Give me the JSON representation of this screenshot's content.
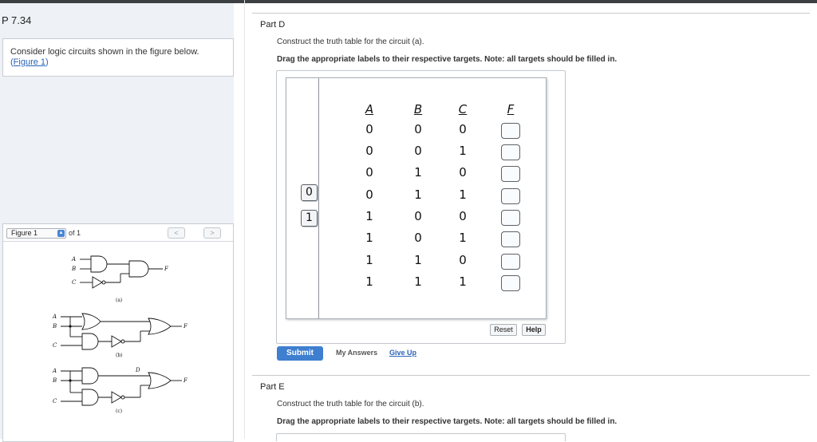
{
  "problem": {
    "title": "P 7.34",
    "context": "Consider logic circuits shown in the figure below.",
    "figure_link": {
      "open": "(",
      "text": "Figure 1",
      "close": ")"
    }
  },
  "figure_viewer": {
    "select_value": "Figure 1",
    "of_label": "of 1",
    "prev_symbol": "<",
    "next_symbol": ">",
    "circuit_labels": {
      "a": {
        "in1": "A",
        "in2": "B",
        "in3": "C",
        "out": "F",
        "caption": "(a)"
      },
      "b": {
        "in1": "A",
        "in2": "B",
        "in3": "C",
        "out": "F",
        "caption": "(b)"
      },
      "c": {
        "in1": "A",
        "in2": "B",
        "in3": "C",
        "internal": "D",
        "out": "F",
        "caption": "(c)"
      }
    }
  },
  "part_d": {
    "title": "Part D",
    "instruction": "Construct the truth table for the circuit (a).",
    "drag_instruction": "Drag the appropriate labels to their respective targets. Note: all targets should be filled in.",
    "label_tiles": [
      "0",
      "1"
    ],
    "truth_table": {
      "headers": [
        "A",
        "B",
        "C",
        "F"
      ],
      "rows": [
        [
          "0",
          "0",
          "0"
        ],
        [
          "0",
          "0",
          "1"
        ],
        [
          "0",
          "1",
          "0"
        ],
        [
          "0",
          "1",
          "1"
        ],
        [
          "1",
          "0",
          "0"
        ],
        [
          "1",
          "0",
          "1"
        ],
        [
          "1",
          "1",
          "0"
        ],
        [
          "1",
          "1",
          "1"
        ]
      ]
    },
    "reset_label": "Reset",
    "help_label": "Help",
    "submit_label": "Submit",
    "my_answers_label": "My Answers",
    "give_up_label": "Give Up"
  },
  "part_e": {
    "title": "Part E",
    "instruction": "Construct the truth table for the circuit (b).",
    "drag_instruction": "Drag the appropriate labels to their respective targets. Note: all targets should be filled in."
  }
}
